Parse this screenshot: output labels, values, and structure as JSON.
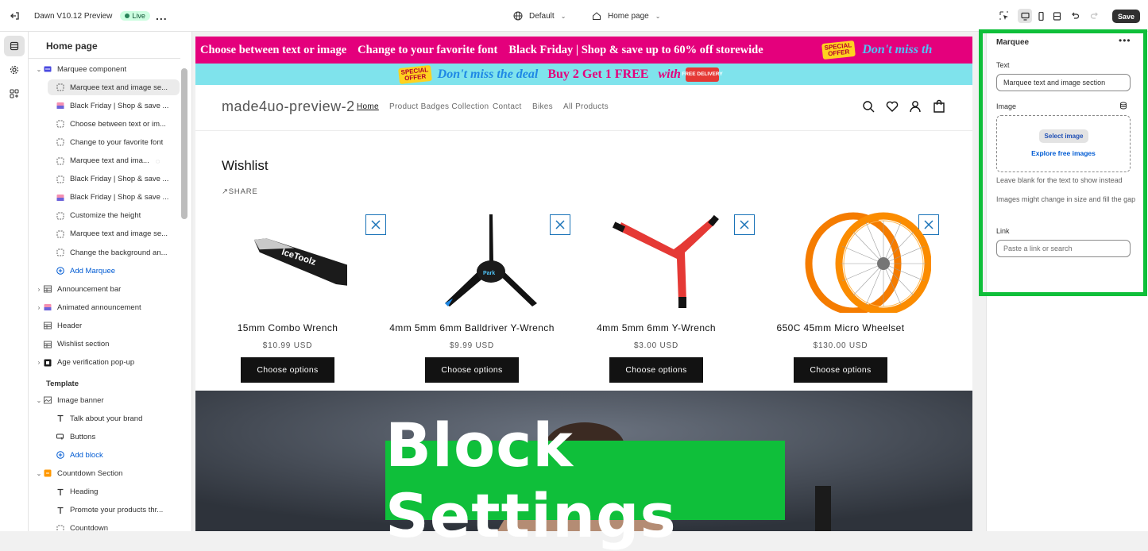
{
  "topbar": {
    "theme_name": "Dawn V10.12 Preview",
    "live_badge": "Live",
    "more_label": "...",
    "theme_selector": "Default",
    "page_selector": "Home page",
    "save_label": "Save"
  },
  "sidebar": {
    "title": "Home page",
    "items": [
      {
        "label": "Marquee component",
        "level": 0,
        "icon": "marquee-icon"
      },
      {
        "label": "Marquee text and image se...",
        "level": 1,
        "icon": "block-icon",
        "selected": true
      },
      {
        "label": "Black Friday | Shop & save ...",
        "level": 1,
        "icon": "image-thumb-icon"
      },
      {
        "label": "Choose between text or im...",
        "level": 1,
        "icon": "block-icon"
      },
      {
        "label": "Change to your favorite font",
        "level": 1,
        "icon": "block-icon"
      },
      {
        "label": "Marquee text and ima...",
        "level": 1,
        "icon": "block-icon"
      },
      {
        "label": "Black Friday | Shop & save ...",
        "level": 1,
        "icon": "block-icon"
      },
      {
        "label": "Black Friday | Shop & save ...",
        "level": 1,
        "icon": "image-thumb-icon"
      },
      {
        "label": "Customize the height",
        "level": 1,
        "icon": "block-icon"
      },
      {
        "label": "Marquee text and image se...",
        "level": 1,
        "icon": "block-icon"
      },
      {
        "label": "Change the background an...",
        "level": 1,
        "icon": "block-icon"
      },
      {
        "label": "Add Marquee",
        "level": 1,
        "icon": "add-icon"
      },
      {
        "label": "Announcement bar",
        "level": 0,
        "icon": "section-icon"
      },
      {
        "label": "Animated announcement",
        "level": 0,
        "icon": "image-thumb-icon"
      },
      {
        "label": "Header",
        "level": 0,
        "icon": "section-icon"
      },
      {
        "label": "Wishlist section",
        "level": 0,
        "icon": "section-icon"
      },
      {
        "label": "Age verification pop-up",
        "level": 0,
        "icon": "popup-icon"
      }
    ],
    "template_heading": "Template",
    "template_items": [
      {
        "label": "Image banner",
        "level": 0,
        "icon": "image-banner-icon"
      },
      {
        "label": "Talk about your brand",
        "level": 1,
        "icon": "text-icon"
      },
      {
        "label": "Buttons",
        "level": 1,
        "icon": "buttons-icon"
      },
      {
        "label": "Add block",
        "level": 1,
        "icon": "add-icon"
      },
      {
        "label": "Countdown Section",
        "level": 0,
        "icon": "countdown-icon"
      },
      {
        "label": "Heading",
        "level": 1,
        "icon": "text-icon"
      },
      {
        "label": "Promote your products thr...",
        "level": 1,
        "icon": "text-icon"
      },
      {
        "label": "Countdown",
        "level": 1,
        "icon": "block-icon"
      }
    ]
  },
  "preview": {
    "marquee_top": [
      "Choose between text or image",
      "Change to your favorite font",
      "Black Friday | Shop & save up to 60% off storewide",
      "Don't miss th"
    ],
    "special_offer": [
      "SPECIAL",
      "OFFER"
    ],
    "marquee_bottom": [
      "Don't miss the deal",
      "Buy 2 Get 1 FREE",
      "with"
    ],
    "free_delivery": "FREE DELIVERY",
    "store_name": "made4uo-preview-2",
    "nav": [
      "Home",
      "Product Badges Collection",
      "Contact",
      "Bikes",
      "All Products"
    ],
    "wishlist_title": "Wishlist",
    "share_label": "SHARE",
    "products": [
      {
        "name": "15mm Combo Wrench",
        "price": "$10.99 USD",
        "button": "Choose options"
      },
      {
        "name": "4mm 5mm 6mm Balldriver Y-Wrench",
        "price": "$9.99 USD",
        "button": "Choose options"
      },
      {
        "name": "4mm 5mm 6mm Y-Wrench",
        "price": "$3.00 USD",
        "button": "Choose options"
      },
      {
        "name": "650C 45mm Micro Wheelset",
        "price": "$130.00 USD",
        "button": "Choose options"
      }
    ],
    "overlay_text": "Block Settings",
    "wrench_brand": "IceToolz",
    "ywrench_brand": "Park"
  },
  "settings": {
    "title": "Marquee",
    "text_label": "Text",
    "text_value": "Marquee text and image section",
    "image_label": "Image",
    "select_image": "Select image",
    "explore_images": "Explore free images",
    "hint_blank": "Leave blank for the text to show instead",
    "hint_images": "Images might change in size and fill the gap",
    "link_label": "Link",
    "link_placeholder": "Paste a link or search"
  },
  "colors": {
    "highlight": "#0fbf3a",
    "marquee_pink": "#e4007c",
    "marquee_cyan": "#7fe3ec",
    "link_blue": "#005bd3"
  }
}
